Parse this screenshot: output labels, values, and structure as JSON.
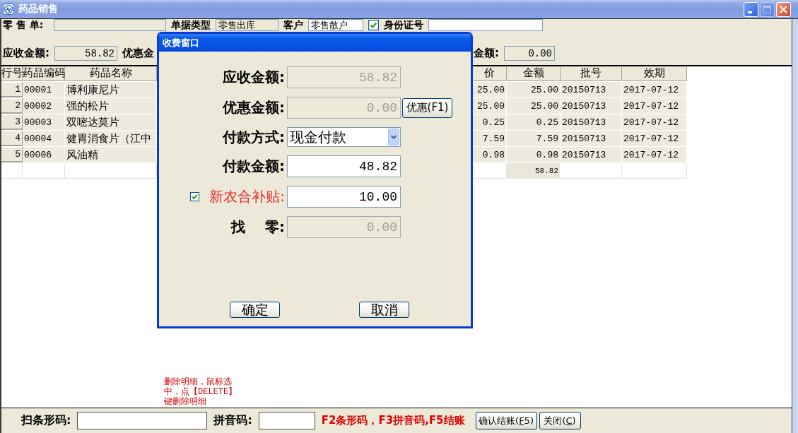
{
  "window": {
    "title": "药品销售",
    "controls": [
      {
        "kind": "minimize",
        "disabled": false
      },
      {
        "kind": "maximize",
        "disabled": true
      },
      {
        "kind": "close",
        "disabled": false
      }
    ]
  },
  "header": {
    "rows": [
      [
        {
          "kind": "label",
          "text": "零 售 单:"
        },
        {
          "kind": "field",
          "disabled": true
        },
        {
          "kind": "label",
          "text": "单据类型"
        },
        {
          "kind": "field",
          "value": "零售出库",
          "disabled": true
        },
        {
          "kind": "label",
          "text": "客户"
        },
        {
          "kind": "field",
          "value": "零售散户",
          "disabled": false
        },
        {
          "kind": "checkbox",
          "checked": true
        },
        {
          "kind": "label",
          "text": "身份证号"
        },
        {
          "kind": "field",
          "disabled": false
        }
      ],
      [
        {
          "kind": "label",
          "text": "应收金额:"
        },
        {
          "kind": "amount",
          "value": "58.82",
          "disabled": true
        },
        {
          "kind": "label",
          "text": "优惠金"
        },
        {
          "kind": "label",
          "text": "金额:"
        },
        {
          "kind": "amount",
          "value": "0.00",
          "disabled": true
        }
      ]
    ]
  },
  "table": {
    "columns": [
      "行号",
      "药品编码",
      "药品名称",
      "价",
      "金额",
      "批号",
      "效期"
    ],
    "rows": [
      {
        "line": "1",
        "code": "00001",
        "name": "博利康尼片",
        "price": "25.00",
        "amount": "25.00",
        "batch": "20150713",
        "expiry": "2017-07-12"
      },
      {
        "line": "2",
        "code": "00002",
        "name": "强的松片",
        "price": "25.00",
        "amount": "25.00",
        "batch": "20150713",
        "expiry": "2017-07-12"
      },
      {
        "line": "3",
        "code": "00003",
        "name": "双嘧达莫片",
        "price": "0.25",
        "amount": "0.25",
        "batch": "20150713",
        "expiry": "2017-07-12"
      },
      {
        "line": "4",
        "code": "00004",
        "name": "健胃消食片（江中",
        "price": "7.59",
        "amount": "7.59",
        "batch": "20150713",
        "expiry": "2017-07-12"
      },
      {
        "line": "5",
        "code": "00006",
        "name": "风油精",
        "price": "0.98",
        "amount": "0.98",
        "batch": "20150713",
        "expiry": "2017-07-12"
      }
    ],
    "total": {
      "amount": "58.82"
    }
  },
  "note": "删除明细，鼠标选中，点【DELETE】键删除明细",
  "dialog": {
    "title": "收费窗口",
    "rows": [
      {
        "kind": "amount",
        "label": "应收金额:",
        "value": "58.82",
        "disabled": true
      },
      {
        "kind": "amount",
        "label": "优惠金额:",
        "value": "0.00",
        "disabled": true,
        "button": "优惠(F1)"
      },
      {
        "kind": "select",
        "label": "付款方式:",
        "value": "现金付款"
      },
      {
        "kind": "amount",
        "label": "付款金额:",
        "value": "48.82",
        "disabled": false
      },
      {
        "kind": "checked_amount",
        "label": "新农合补贴:",
        "checked": true,
        "value": "10.00",
        "disabled": false
      },
      {
        "kind": "amount",
        "label": "找    零:",
        "value": "0.00",
        "disabled": true
      }
    ],
    "buttons": [
      "确定",
      "取消"
    ]
  },
  "footer": {
    "barcode_label": "扫条形码:",
    "pinyin_label": "拼音码:",
    "hint": "F2条形码，F3拼音码,F5结账",
    "buttons": [
      {
        "label": "确认结账(F5)",
        "shortcut_underlined": true
      },
      {
        "label": "关闭(C)",
        "shortcut_underlined": true
      }
    ]
  }
}
